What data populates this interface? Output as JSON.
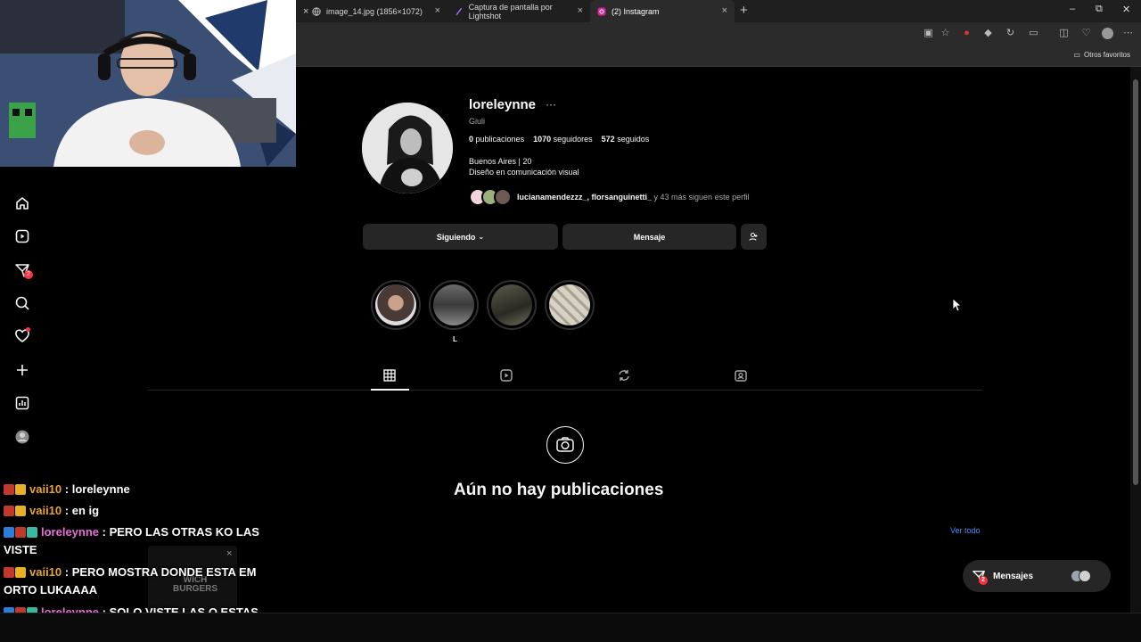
{
  "browser": {
    "tabs": [
      {
        "title": "image_14.jpg (1856×1072)"
      },
      {
        "title": "Captura de pantalla por Lightshot"
      },
      {
        "title": "(2) Instagram"
      }
    ],
    "bookmarks_folder": "Otros favoritos"
  },
  "sidebar": {
    "items": [
      {
        "icon": "home-icon"
      },
      {
        "icon": "reels-icon"
      },
      {
        "icon": "direct-icon",
        "badge": "2"
      },
      {
        "icon": "search-icon"
      },
      {
        "icon": "heart-icon"
      },
      {
        "icon": "create-icon"
      },
      {
        "icon": "dashboard-icon"
      },
      {
        "icon": "profile-avatar"
      }
    ]
  },
  "profile": {
    "username": "loreleynne",
    "more": "···",
    "full_name": "Giuli",
    "posts_count": "0",
    "posts_label": "publicaciones",
    "followers_count": "1070",
    "followers_label": "seguidores",
    "following_count": "572",
    "following_label": "seguidos",
    "bio_line1": "Buenos Aires | 20",
    "bio_line2": "Diseño en comunicación visual",
    "followed_by_names": "lucianamendezzz_, florsanguinetti_",
    "followed_by_rest": " y 43 más siguen este perfil",
    "following_button": "Siguiendo",
    "message_button": "Mensaje"
  },
  "highlights": [
    {
      "label": ""
    },
    {
      "label": "L"
    },
    {
      "label": ""
    },
    {
      "label": ""
    }
  ],
  "empty_state": {
    "title": "Aún no hay publicaciones"
  },
  "suggestions": {
    "see_all": "Ver todo"
  },
  "messages_pill": {
    "label": "Mensajes",
    "badge": "2"
  },
  "chat": [
    {
      "user": "vaii10",
      "text": " : loreleynne",
      "color": "#e8a33a"
    },
    {
      "user": "vaii10",
      "text": " : en ig",
      "color": "#e8a33a"
    },
    {
      "user": "loreleynne",
      "text": " : PERO LAS OTRAS KO LAS VISTE",
      "color": "#e86fd8"
    },
    {
      "user": "vaii10",
      "text": " : PERO MOSTRA DONDE ESTA EM ORTO LUKAAAA",
      "color": "#e8a33a"
    },
    {
      "user": "loreleynne",
      "text": " : SOLO VISTE LAS Q ESTAS CON VOS",
      "color": "#e86fd8"
    }
  ],
  "ad": {
    "brand_line1": "WICH",
    "brand_line2": "BURGERS"
  },
  "colors": {
    "background": "#000000",
    "button": "#262626",
    "link": "#4a8cff",
    "notification": "#ff3040"
  }
}
